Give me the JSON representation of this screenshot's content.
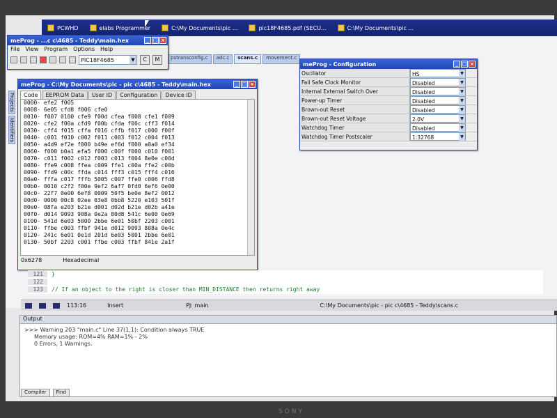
{
  "taskbar": {
    "items": [
      {
        "label": "PCWHD"
      },
      {
        "label": "elabs Programmer"
      },
      {
        "label": "C:\\My Documents\\pic ..."
      },
      {
        "label": "pic18F4685.pdf (SECU..."
      },
      {
        "label": "C:\\My Documents\\pic ..."
      }
    ]
  },
  "meprog_small": {
    "title": "meProg - ...c c\\4685 - Teddy\\main.hex",
    "menu": [
      "File",
      "View",
      "Program",
      "Options",
      "Help"
    ],
    "device": "PIC18F4685",
    "btn_c": "C",
    "btn_m": "M"
  },
  "editor_tabs": [
    "pstransconfig.c",
    "adc.c",
    "scans.c",
    "movement.c"
  ],
  "hexwin": {
    "title": "meProg - C:\\My Documents\\pic - pic c\\4685 - Teddy\\main.hex",
    "tabs": [
      "Code",
      "EEPROM Data",
      "User ID",
      "Configuration",
      "Device ID"
    ],
    "rows": [
      "0000- efe2 f005",
      "0008- 6e05 cfd8 f006 cfe0",
      "0010- f007 0100 cfe9 f00d cfea f008 cfe1 f009",
      "0020- cfe2 f00a cfd9 f00b cfda f00c cff3 f014",
      "0030- cff4 f015 cffa f016 cffb f017 c000 f00f",
      "0040- c001 f010 c002 f011 c003 f012 c004 f013",
      "0050- a4d9 ef2e f000 b49e ef6d f000 a0a0 ef34",
      "0060- f000 b0a1 efa5 f000 c00f f000 c010 f001",
      "0070- c011 f002 c012 f003 c013 f004 8e0e c00d",
      "0080- ffe9 c008 ffea c009 ffe1 c00a ffe2 c00b",
      "0090- ffd9 c00c ffda c014 fff3 c015 fff4 c016",
      "00a0- fffa c017 fffb 5005 c007 ffe0 c006 ffd8",
      "00b0- 0010 c2f2 f00e 9ef2 6af7 0fd0 6ef6 0e00",
      "00c0- 22f7 0e00 6ef8 0009 50f5 be0e 8ef2 0012",
      "00d0- 0000 00c8 02ee 03e8 0bb8 5220 e103 501f",
      "00e0- 08fa e203 b21e d001 d02d b21e d02b a41e",
      "00f0- d014 9093 908a 0e2a 80d8 541c 6e00 0e69",
      "0100- 541d 6e03 5000 2bbe 6e01 50bf 2203 c001",
      "0110- ffbe c003 ffbf 941e d012 9093 808a 0e4c",
      "0120- 241c 6e01 0e1d 201d 6e03 5001 2bbe 6e01",
      "0130- 50bf 2203 c001 ffbe c003 ffbf 841e 2a1f"
    ],
    "status_addr": "0x6278",
    "status_mode": "Hexadecimal"
  },
  "config": {
    "title": "meProg - Configuration",
    "rows": [
      {
        "label": "Oscillator",
        "value": "HS"
      },
      {
        "label": "Fail Safe Clock Monitor",
        "value": "Disabled"
      },
      {
        "label": "Internal External Switch Over",
        "value": "Disabled"
      },
      {
        "label": "Power-up Timer",
        "value": "Disabled"
      },
      {
        "label": "Brown-out Reset",
        "value": "Disabled"
      },
      {
        "label": "Brown-out Reset Voltage",
        "value": "2.0V"
      },
      {
        "label": "Watchdog Timer",
        "value": "Disabled"
      },
      {
        "label": "Watchdog Timer Postscaler",
        "value": "1:32768"
      }
    ]
  },
  "editor": {
    "lines": [
      {
        "num": "121",
        "text": "}"
      },
      {
        "num": "122",
        "text": ""
      },
      {
        "num": "123",
        "text": "// If an object to the right is closer than MIN_DISTANCE then returns right away"
      }
    ]
  },
  "statusbar": {
    "pos": "113:16",
    "mode": "Insert",
    "pj": "PJ: main",
    "file": "C:\\My Documents\\pic - pic c\\4685 - Teddy\\scans.c"
  },
  "output": {
    "header": "Output",
    "lines": [
      ">>> Warning 203 \"main.c\" Line 37(1,1): Condition always TRUE",
      "Memory usage:   ROM=4%     RAM=1% - 2%",
      "0 Errors,  1 Warnings."
    ],
    "tabs": [
      "Compiler",
      "Find"
    ]
  },
  "sidetabs": [
    "Projects",
    "Identifiers"
  ],
  "brand": "SONY"
}
